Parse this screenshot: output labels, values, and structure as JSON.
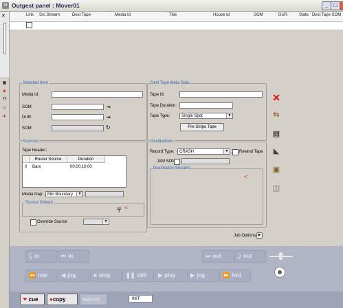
{
  "window": {
    "title": "Outgest panel : Mover01"
  },
  "queue": {
    "columns": [
      "Link",
      "Src Stream",
      "Dest Tape",
      "Media Id",
      "Title",
      "House Id",
      "SOM",
      "DUR",
      "State",
      "Dest Tape SOM"
    ]
  },
  "selected_item": {
    "legend": "Selected Item",
    "media_id_label": "Media Id:",
    "som_label": "SOM:",
    "dur_label": "DUR:",
    "som2_label": "SOM:"
  },
  "dest_tape": {
    "legend": "Dest Tape Meta Data",
    "tape_id_label": "Tape Id:",
    "tape_duration_label": "Tape Duration:",
    "tape_type_label": "Tape Type:",
    "tape_type_value": "Single Spot",
    "prestripe_label": "Pre-Stripe Tape"
  },
  "sources": {
    "legend": "Sources",
    "tape_header_label": "Tape Header:",
    "columns": [
      "Router Source",
      "Duration"
    ],
    "rows": [
      {
        "index": "0",
        "source": "Bars",
        "duration": "00:00:10:00"
      }
    ],
    "media_gap_label": "Media Gap:",
    "media_gap_value": "Min Boundary",
    "source_stream_legend": "Source Stream",
    "override_label": "Override Source"
  },
  "destinations": {
    "legend": "Destinations",
    "record_type_label": "Record Type:",
    "record_type_value": "CRASH",
    "rewind_label": "Rewind Tape",
    "jam_som_label": "JAM SOM:",
    "dest_streams_legend": "Destination Streams"
  },
  "job_options_label": "Job Options:",
  "transport": {
    "in1": "in",
    "in2": "in",
    "out1": "out",
    "out2": "out",
    "rew": "rew",
    "jog1": "jog",
    "stop": "stop",
    "still": "still",
    "play": "play",
    "jog2": "jog",
    "fwd": "fwd"
  },
  "bottom": {
    "cue": "cue",
    "copy": "copy",
    "abort": "abort",
    "status": "INIT"
  },
  "colors": {
    "accent_label": "#3060b0",
    "delete": "#e01010",
    "copy_record": "#e01010"
  }
}
